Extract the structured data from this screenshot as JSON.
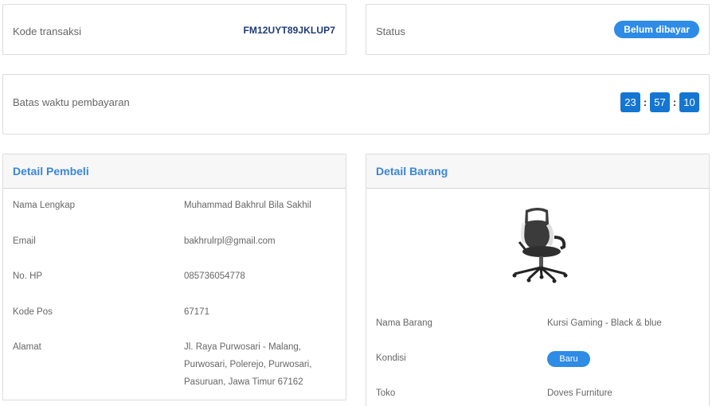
{
  "transaction": {
    "kode_label": "Kode transaksi",
    "kode_value": "FM12UYT89JKLUP7",
    "status_label": "Status",
    "status_value": "Belum dibayar",
    "batas_label": "Batas waktu pembayaran",
    "timer": {
      "hours": "23",
      "minutes": "57",
      "seconds": "10",
      "separator": ":"
    }
  },
  "pembeli": {
    "title": "Detail Pembeli",
    "rows": [
      {
        "label": "Nama Lengkap",
        "value": "Muhammad Bakhrul Bila Sakhil"
      },
      {
        "label": "Email",
        "value": "bakhrulrpl@gmail.com"
      },
      {
        "label": "No. HP",
        "value": "085736054778"
      },
      {
        "label": "Kode Pos",
        "value": "67171"
      },
      {
        "label": "Alamat",
        "value_lines": [
          "Jl. Raya Purwosari - Malang,",
          "Purwosari, Polerejo, Purwosari,",
          "Pasuruan, Jawa Timur 67162"
        ]
      }
    ]
  },
  "barang": {
    "title": "Detail Barang",
    "image_icon": "gaming-chair-image",
    "rows": [
      {
        "label": "Nama Barang",
        "value": "Kursi Gaming - Black & blue"
      },
      {
        "label": "Kondisi",
        "value": "Baru"
      },
      {
        "label": "Toko",
        "value": "Doves Furniture"
      }
    ]
  },
  "colors": {
    "accent": "#2e8be6",
    "timer_box": "#1476d2",
    "code_text": "#1e3a78",
    "heading_text": "#3a86d6"
  }
}
